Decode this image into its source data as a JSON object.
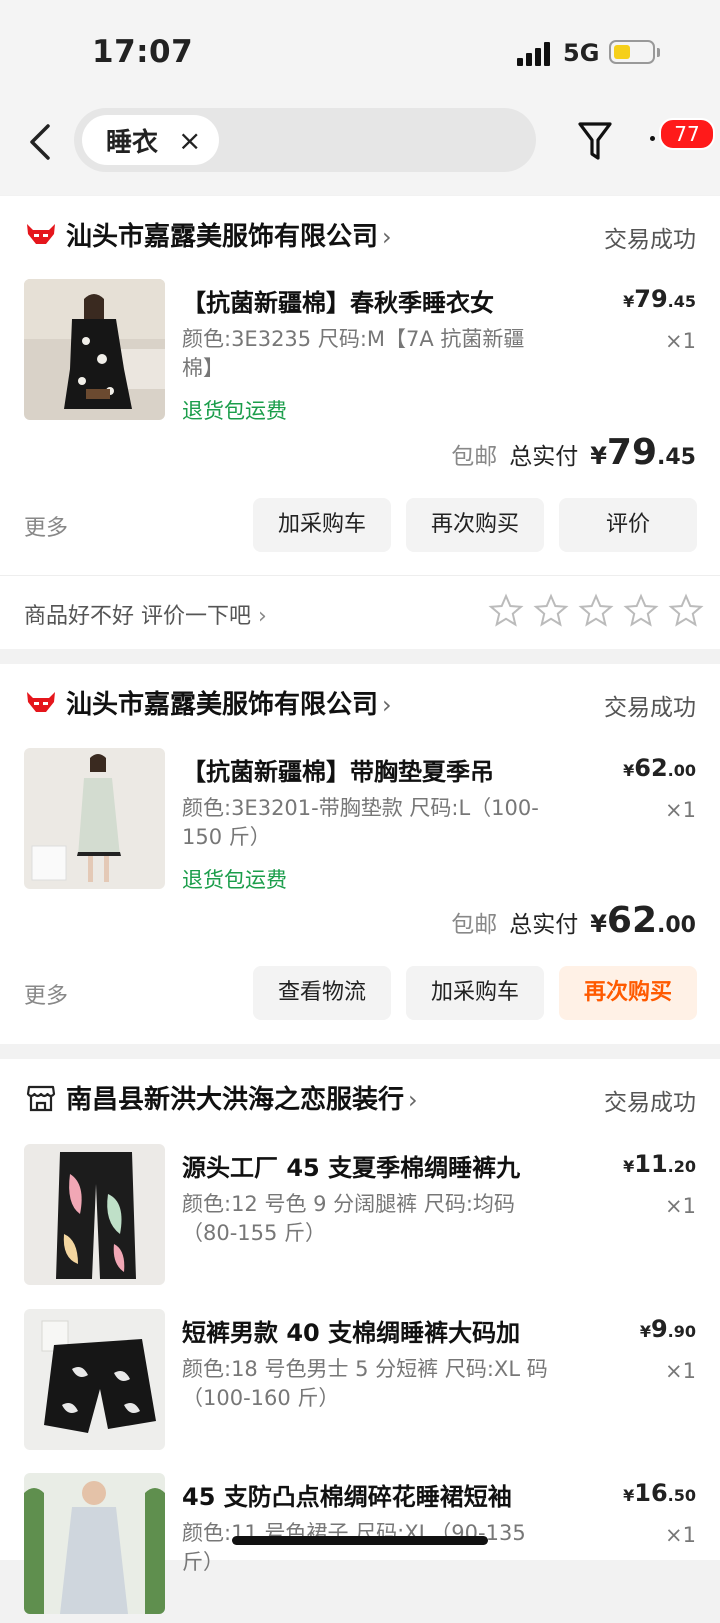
{
  "status_bar": {
    "time": "17:07",
    "network": "5G"
  },
  "search": {
    "chip_text": "睡衣",
    "chip_close": "×"
  },
  "header": {
    "badge_count": "77"
  },
  "orders": [
    {
      "shop_name": "汕头市嘉露美服饰有限公司",
      "status": "交易成功",
      "items": [
        {
          "title": "【抗菌新疆棉】春秋季睡衣女",
          "spec": "颜色:3E3235 尺码:M【7A 抗菌新疆棉】",
          "tag": "退货包运费",
          "price_symbol": "¥",
          "price_int": "79",
          "price_dec": ".45",
          "qty": "×1"
        }
      ],
      "free_shipping": "包邮",
      "total_label": "总实付",
      "total_symbol": "¥",
      "total_int": "79",
      "total_dec": ".45",
      "more": "更多",
      "buttons": [
        "加采购车",
        "再次购买",
        "评价"
      ],
      "review_prompt": "商品好不好 评价一下吧"
    },
    {
      "shop_name": "汕头市嘉露美服饰有限公司",
      "status": "交易成功",
      "items": [
        {
          "title": "【抗菌新疆棉】带胸垫夏季吊",
          "spec": "颜色:3E3201-带胸垫款 尺码:L（100-150 斤）",
          "tag": "退货包运费",
          "price_symbol": "¥",
          "price_int": "62",
          "price_dec": ".00",
          "qty": "×1"
        }
      ],
      "free_shipping": "包邮",
      "total_label": "总实付",
      "total_symbol": "¥",
      "total_int": "62",
      "total_dec": ".00",
      "more": "更多",
      "buttons": [
        "查看物流",
        "加采购车",
        "再次购买"
      ]
    },
    {
      "shop_name": "南昌县新洪大洪海之恋服装行",
      "status": "交易成功",
      "items": [
        {
          "title": "源头工厂 45 支夏季棉绸睡裤九",
          "spec": "颜色:12 号色 9 分阔腿裤 尺码:均码（80-155 斤）",
          "price_symbol": "¥",
          "price_int": "11",
          "price_dec": ".20",
          "qty": "×1"
        },
        {
          "title": "短裤男款 40 支棉绸睡裤大码加",
          "spec": "颜色:18 号色男士 5 分短裤 尺码:XL 码（100-160 斤）",
          "price_symbol": "¥",
          "price_int": "9",
          "price_dec": ".90",
          "qty": "×1"
        },
        {
          "title": "45 支防凸点棉绸碎花睡裙短袖",
          "spec": "颜色:11 号色裙子 尺码:XL（90-135 斤）",
          "price_symbol": "¥",
          "price_int": "16",
          "price_dec": ".50",
          "qty": "×1"
        }
      ]
    }
  ],
  "colors": {
    "accent_orange": "#ff5a00",
    "badge_red": "#ff1a1a",
    "tag_green": "#1a9d4a",
    "tmall_red": "#e5161c"
  }
}
